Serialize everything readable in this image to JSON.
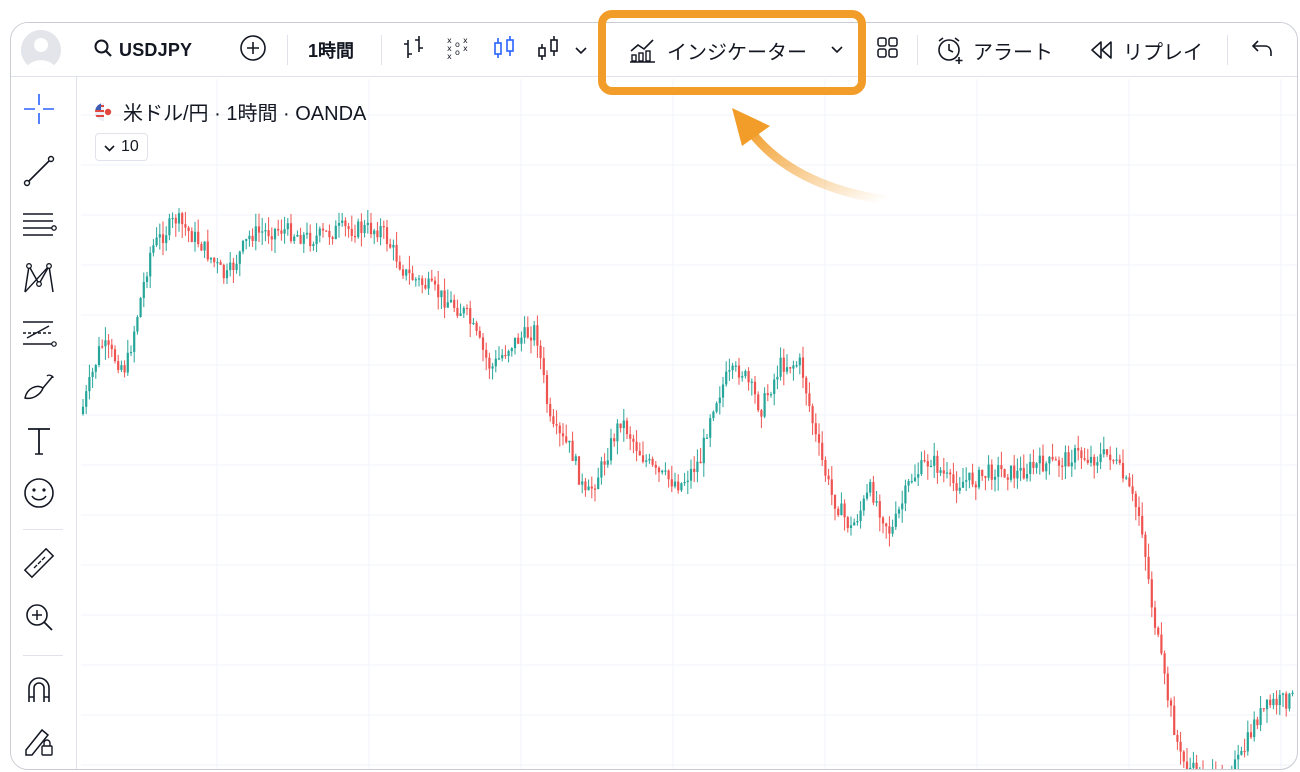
{
  "toolbar": {
    "symbol": "USDJPY",
    "timeframe": "1時間",
    "indicators_label": "インジケーター",
    "alert_label": "アラート",
    "replay_label": "リプレイ"
  },
  "chart": {
    "legend_title": "米ドル/円 · 1時間 · OANDA",
    "volume_toggle_label": "10"
  },
  "icons": {
    "search": "search-icon",
    "add": "plus-circle-icon",
    "bars": "bar-chart-icon",
    "point_figure": "point-figure-icon",
    "candles": "candles-icon",
    "hollow": "hollow-candles-icon",
    "templates": "templates-icon",
    "alert": "alarm-clock-icon",
    "replay": "rewind-icon",
    "undo": "undo-icon"
  },
  "colors": {
    "up": "#26a69a",
    "down": "#ef5350",
    "highlight": "#f29d29",
    "accent_blue": "#2962ff"
  }
}
